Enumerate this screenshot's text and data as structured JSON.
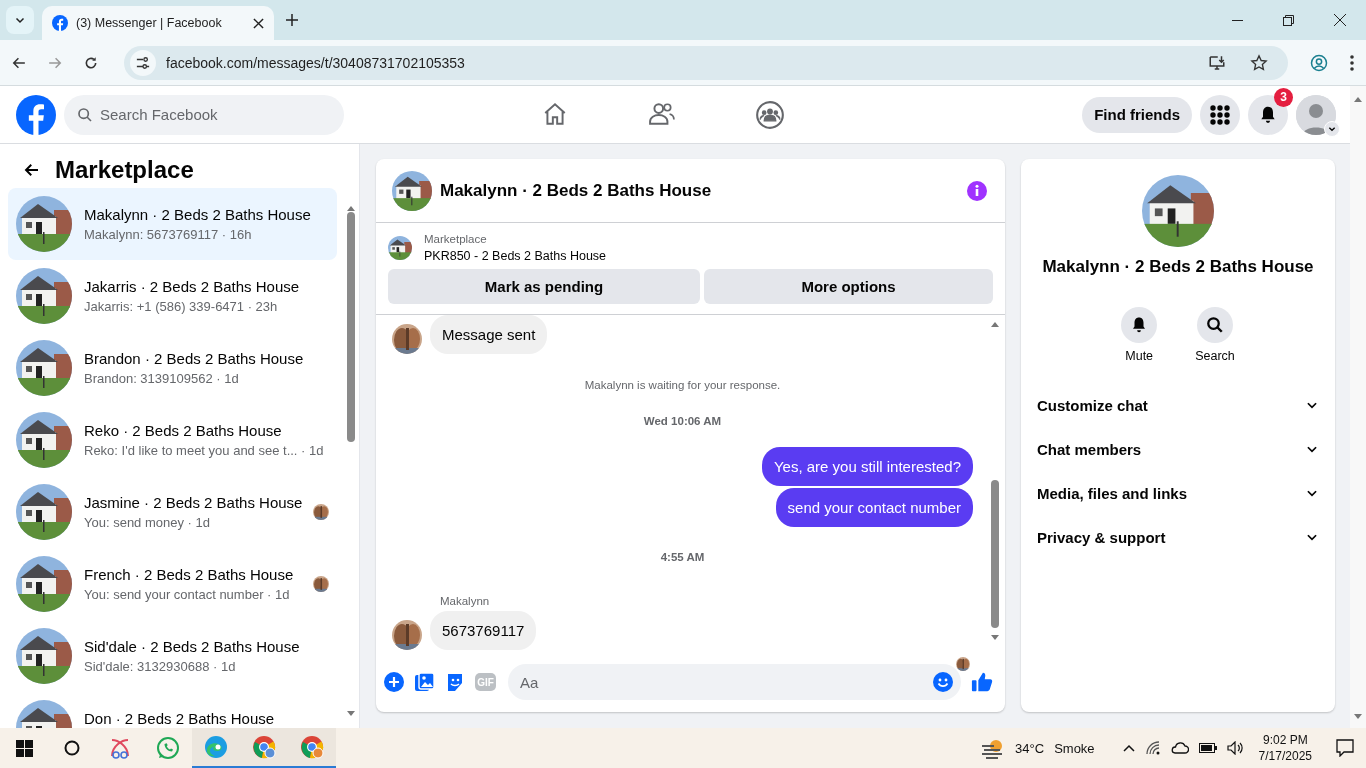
{
  "browser": {
    "tabs": [
      {
        "title": "(3) Messenger | Facebook",
        "selected": true
      }
    ],
    "url": "facebook.com/messages/t/30408731702105353"
  },
  "topbar": {
    "search": {
      "placeholder": "Search Facebook"
    },
    "find_friends": "Find friends",
    "notification_count": "3"
  },
  "sidebar": {
    "title": "Marketplace",
    "conversations": [
      {
        "title": "Makalynn · 2 Beds 2 Baths House",
        "preview": "Makalynn: 5673769117 · 16h",
        "selected": true,
        "seen": false
      },
      {
        "title": "Jakarris · 2 Beds 2 Baths House",
        "preview": "Jakarris: +1 (586) 339-6471 · 23h",
        "selected": false,
        "seen": false
      },
      {
        "title": "Brandon · 2 Beds 2 Baths House",
        "preview": "Brandon: 3139109562 · 1d",
        "selected": false,
        "seen": false
      },
      {
        "title": "Reko · 2 Beds 2 Baths House",
        "preview": "Reko: I'd like to meet you and see t... · 1d",
        "selected": false,
        "seen": false
      },
      {
        "title": "Jasmine · 2 Beds 2 Baths House",
        "preview": "You: send money · 1d",
        "selected": false,
        "seen": true
      },
      {
        "title": "French · 2 Beds 2 Baths House",
        "preview": "You: send your contact number · 1d",
        "selected": false,
        "seen": true
      },
      {
        "title": "Sid'dale · 2 Beds 2 Baths House",
        "preview": "Sid'dale: 3132930688 · 1d",
        "selected": false,
        "seen": false
      },
      {
        "title": "Don · 2 Beds 2 Baths House",
        "selected": false,
        "seen": false
      }
    ]
  },
  "chat": {
    "title": "Makalynn · 2 Beds 2 Baths House",
    "listing": {
      "label": "Marketplace",
      "name": "PKR850 - 2 Beds 2 Baths House"
    },
    "actions": [
      "Mark as pending",
      "More options"
    ],
    "messages": [
      {
        "kind": "incoming",
        "text": "Message sent"
      },
      {
        "kind": "notice",
        "text": "Makalynn is waiting for your response."
      },
      {
        "kind": "timestamp",
        "text": "Wed 10:06 AM"
      },
      {
        "kind": "outgoing",
        "text": "Yes, are you still interested?"
      },
      {
        "kind": "outgoing",
        "text": "send your contact number"
      },
      {
        "kind": "timestamp",
        "text": "4:55 AM"
      },
      {
        "kind": "sender",
        "text": "Makalynn"
      },
      {
        "kind": "incoming",
        "text": "5673769117"
      }
    ],
    "seen": true,
    "gif_label": "GIF",
    "composer": {
      "placeholder": "Aa"
    }
  },
  "details": {
    "title": "Makalynn · 2 Beds 2 Baths House",
    "actions": [
      {
        "kind": "mute",
        "label": "Mute"
      },
      {
        "kind": "search",
        "label": "Search"
      }
    ],
    "sections": [
      {
        "label": "Customize chat",
        "expanded": false
      },
      {
        "label": "Chat members",
        "expanded": false
      },
      {
        "label": "Media, files and links",
        "expanded": false
      },
      {
        "label": "Privacy & support",
        "expanded": false
      }
    ]
  },
  "taskbar": {
    "weather": {
      "temperature": "34°C",
      "condition": "Smoke"
    },
    "time": "9:02 PM",
    "date": "7/17/2025"
  }
}
